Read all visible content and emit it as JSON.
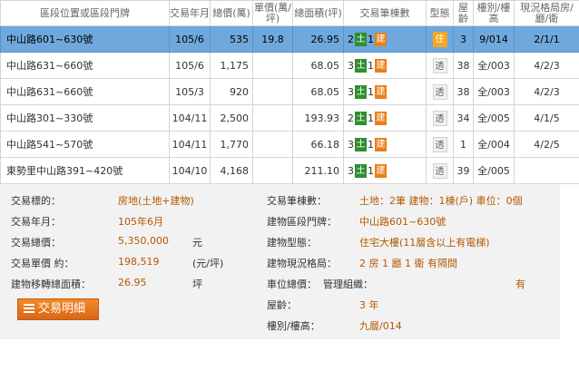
{
  "headers": {
    "addr": "區段位置或區段門牌",
    "date": "交易年月",
    "total": "總價(萬)",
    "unit": "單價(萬/坪)",
    "area": "總面積(坪)",
    "bldg": "交易筆棟數",
    "type": "型態",
    "age": "屋齡",
    "floor": "樓別/樓高",
    "layout": "現況格局房/廳/衛"
  },
  "rows": [
    {
      "addr": "中山路601~630號",
      "date": "105/6",
      "total": "535",
      "unit": "19.8",
      "area": "26.95",
      "n1": "2",
      "n2": "1",
      "g": "土",
      "o": "建",
      "type": "住",
      "age": "3",
      "floor": "9/014",
      "layout": "2/1/1"
    },
    {
      "addr": "中山路631~660號",
      "date": "105/6",
      "total": "1,175",
      "unit": "",
      "area": "68.05",
      "n1": "3",
      "n2": "1",
      "g": "土",
      "o": "建",
      "type": "透",
      "age": "38",
      "floor": "全/003",
      "layout": "4/2/3"
    },
    {
      "addr": "中山路631~660號",
      "date": "105/3",
      "total": "920",
      "unit": "",
      "area": "68.05",
      "n1": "3",
      "n2": "1",
      "g": "土",
      "o": "建",
      "type": "透",
      "age": "38",
      "floor": "全/003",
      "layout": "4/2/3"
    },
    {
      "addr": "中山路301~330號",
      "date": "104/11",
      "total": "2,500",
      "unit": "",
      "area": "193.93",
      "n1": "2",
      "n2": "1",
      "g": "土",
      "o": "建",
      "type": "透",
      "age": "34",
      "floor": "全/005",
      "layout": "4/1/5"
    },
    {
      "addr": "中山路541~570號",
      "date": "104/11",
      "total": "1,770",
      "unit": "",
      "area": "66.18",
      "n1": "3",
      "n2": "1",
      "g": "土",
      "o": "建",
      "type": "透",
      "age": "1",
      "floor": "全/004",
      "layout": "4/2/5"
    },
    {
      "addr": "東勢里中山路391~420號",
      "date": "104/10",
      "total": "4,168",
      "unit": "",
      "area": "211.10",
      "n1": "3",
      "n2": "1",
      "g": "土",
      "o": "建",
      "type": "透",
      "age": "39",
      "floor": "全/005",
      "layout": ""
    }
  ],
  "detail": {
    "left": [
      {
        "label": "交易標的：",
        "value": "房地(土地+建物)",
        "unit": ""
      },
      {
        "label": "交易年月：",
        "value": "105年6月",
        "unit": ""
      },
      {
        "label": "交易總價：",
        "value": "5,350,000",
        "unit": "元"
      },
      {
        "label": "交易單價 約：",
        "value": "198,519",
        "unit": "(元/坪)"
      },
      {
        "label": "建物移轉總面積：",
        "value": "26.95",
        "unit": "坪"
      }
    ],
    "right": [
      {
        "label": "交易筆棟數：",
        "value": "土地：2筆 建物：1棟(戶) 車位：0個"
      },
      {
        "label": "建物區段門牌：",
        "value": "中山路601~630號"
      },
      {
        "label": "建物型態：",
        "value": "住宅大樓(11層含以上有電梯)"
      },
      {
        "label": "建物現況格局：",
        "value": "2 房 1 廳 1 衛 有隔間"
      },
      {
        "label": "車位總價：",
        "value": ""
      },
      {
        "label": "屋齡：",
        "value": "3 年"
      },
      {
        "label": "樓別/樓高：",
        "value": "九層/014"
      }
    ],
    "mgmt_label": "管理組織：",
    "mgmt_value": "有",
    "button_label": "交易明細"
  }
}
